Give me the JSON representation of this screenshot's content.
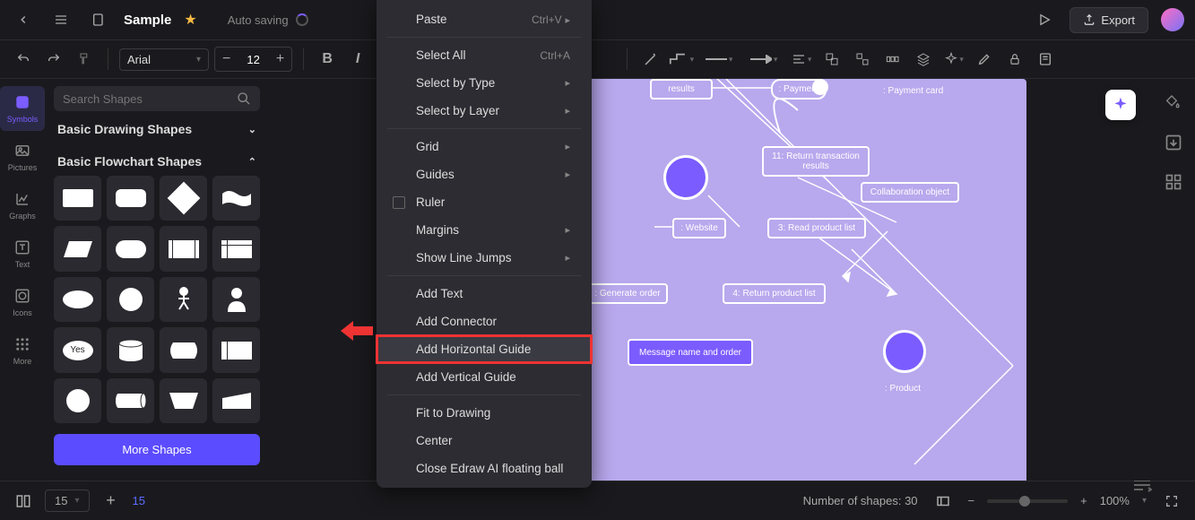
{
  "header": {
    "doc_title": "Sample",
    "autosave": "Auto saving",
    "export_label": "Export"
  },
  "toolbar": {
    "font": "Arial",
    "font_size": "12"
  },
  "rail": {
    "items": [
      {
        "label": "Symbols"
      },
      {
        "label": "Pictures"
      },
      {
        "label": "Graphs"
      },
      {
        "label": "Text"
      },
      {
        "label": "Icons"
      },
      {
        "label": "More"
      }
    ]
  },
  "shapes_panel": {
    "search_placeholder": "Search Shapes",
    "cat1": "Basic Drawing Shapes",
    "cat2": "Basic Flowchart Shapes",
    "more": "More Shapes",
    "yes_label": "Yes"
  },
  "context_menu": {
    "paste": "Paste",
    "paste_sc": "Ctrl+V",
    "select_all": "Select All",
    "select_all_sc": "Ctrl+A",
    "select_type": "Select by Type",
    "select_layer": "Select by Layer",
    "grid": "Grid",
    "guides": "Guides",
    "ruler": "Ruler",
    "margins": "Margins",
    "line_jumps": "Show Line Jumps",
    "add_text": "Add Text",
    "add_connector": "Add Connector",
    "add_hguide": "Add Horizontal Guide",
    "add_vguide": "Add Vertical Guide",
    "fit": "Fit to Drawing",
    "center": "Center",
    "close_ai": "Close Edraw AI floating ball"
  },
  "canvas": {
    "nodes": {
      "results": "results",
      "payment": ": Payment",
      "payment_card": ": Payment card",
      "return_tx": "11: Return transaction results",
      "collab": "Collaboration object",
      "website": ": Website",
      "read_list": "3: Read product list",
      "gen_order": ": Generate order",
      "return_list": "4: Return product list",
      "msg": "Message name and order",
      "product": ": Product"
    }
  },
  "status": {
    "page_a": "15",
    "page_b": "15",
    "shapes_count": "Number of shapes: 30",
    "zoom": "100%"
  }
}
